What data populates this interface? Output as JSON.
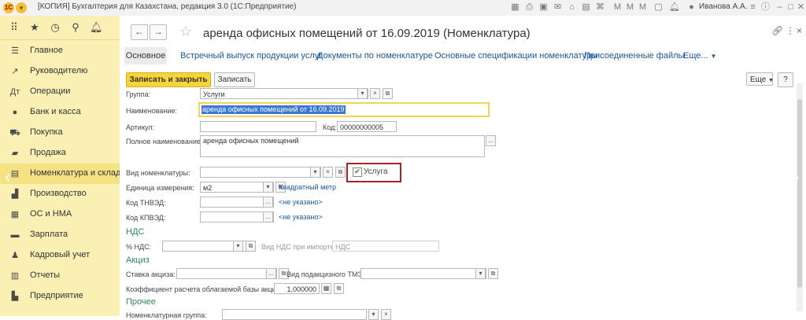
{
  "window": {
    "logo_text": "1C",
    "title": "[КОПИЯ] Бухгалтерия для Казахстана, редакция 3.0  (1С:Предприятие)",
    "user": "Иванова А.А."
  },
  "sidebar": {
    "items": [
      {
        "label": "Главное",
        "icon": "menu-lines"
      },
      {
        "label": "Руководителю",
        "icon": "chart-line"
      },
      {
        "label": "Операции",
        "icon": "operations"
      },
      {
        "label": "Банк и касса",
        "icon": "coin"
      },
      {
        "label": "Покупка",
        "icon": "cart"
      },
      {
        "label": "Продажа",
        "icon": "bag"
      },
      {
        "label": "Номенклатура и склад",
        "icon": "warehouse"
      },
      {
        "label": "Производство",
        "icon": "factory"
      },
      {
        "label": "ОС и НМА",
        "icon": "assets"
      },
      {
        "label": "Зарплата",
        "icon": "salary"
      },
      {
        "label": "Кадровый учет",
        "icon": "person"
      },
      {
        "label": "Отчеты",
        "icon": "reports"
      },
      {
        "label": "Предприятие",
        "icon": "enterprise"
      }
    ],
    "active_index": 6
  },
  "document": {
    "title": "аренда офисных помещений от 16.09.2019 (Номенклатура)",
    "tabs": [
      "Основное",
      "Встречный выпуск продукции услуг",
      "Документы по номенклатуре",
      "Основные спецификации номенклатуры",
      "Присоединенные файлы",
      "Еще..."
    ],
    "buttons": {
      "save_close": "Записать и закрыть",
      "save": "Записать",
      "more": "Еще",
      "help": "?"
    }
  },
  "form": {
    "group_label": "Группа:",
    "group_value": "Услуги",
    "name_label": "Наименование:",
    "name_value": "аренда офисных помещений от 16.09.2019",
    "article_label": "Артикул:",
    "article_value": "",
    "code_label": "Код:",
    "code_value": "00000000005",
    "full_name_label": "Полное наименование:",
    "full_name_value": "аренда офисных помещений",
    "kind_label": "Вид номенклатуры:",
    "kind_value": "",
    "service_label": "Услуга",
    "service_checked": true,
    "unit_label": "Единица измерения:",
    "unit_value": "м2",
    "unit_link": "Квадратный метр",
    "tnved_label": "Код ТНВЭД:",
    "tnved_link": "<не указано>",
    "kpved_label": "Код КПВЭД:",
    "kpved_link": "<не указано>",
    "vat_section": "НДС",
    "vat_label": "% НДС:",
    "vat_import_label": "Вид НДС при импорте:",
    "vat_import_value": "НДС",
    "excise_section": "Акциз",
    "excise_rate_label": "Ставка акциза:",
    "excise_tmz_label": "Вид подакцизного ТМЗ:",
    "coef_label": "Коэффициент расчета облагаемой базы акциза:",
    "coef_value": "1,000000",
    "other_section": "Прочее",
    "nomgroup_label": "Номенклатурная группа:"
  },
  "colors": {
    "sidebar_bg": "#fbf0b4",
    "accent_yellow": "#f6d53a",
    "link_blue": "#1b56a4",
    "section_green": "#2e8b57",
    "highlight_border": "#a0262a"
  }
}
